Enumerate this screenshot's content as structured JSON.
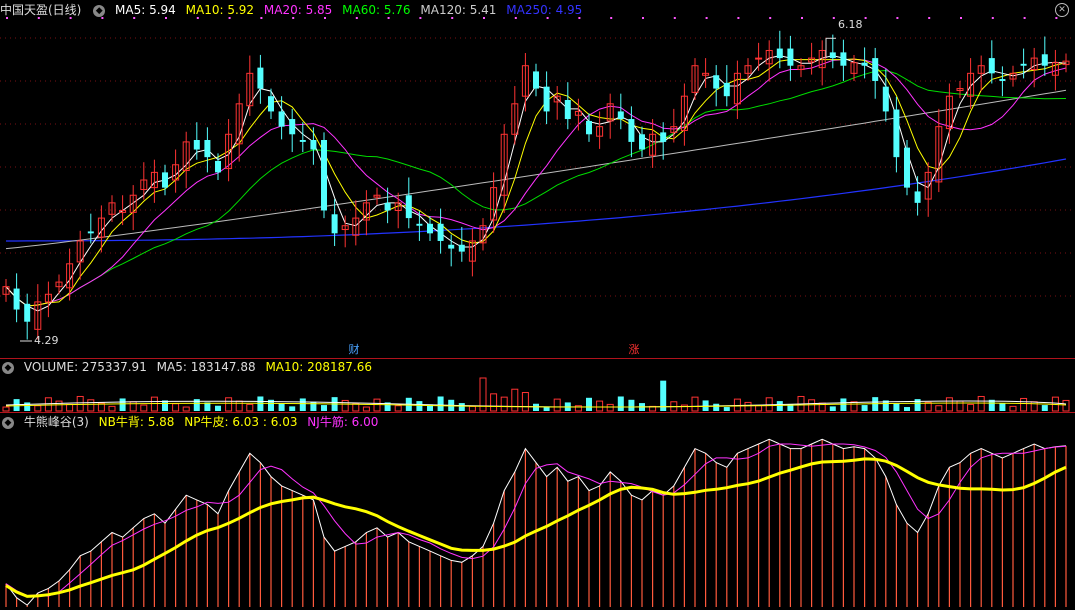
{
  "main": {
    "stock_title": "中国天盈(日线)",
    "ma": [
      {
        "label": "MA5: 5.94",
        "color": "#ffffff"
      },
      {
        "label": "MA10: 5.92",
        "color": "#ffff00"
      },
      {
        "label": "MA20: 5.85",
        "color": "#ff33ff"
      },
      {
        "label": "MA60: 5.76",
        "color": "#00ff00"
      },
      {
        "label": "MA120: 5.41",
        "color": "#cccccc"
      },
      {
        "label": "MA250: 4.95",
        "color": "#3333ff"
      }
    ],
    "high_label": "6.18",
    "low_label": "4.29",
    "event_badges": [
      {
        "text": "财",
        "color": "#4aa3ff"
      },
      {
        "text": "涨",
        "color": "#ff3333"
      }
    ],
    "close_icon": "close-icon"
  },
  "volume": {
    "label": "VOLUME: 275337.91",
    "ma5": "MA5: 183147.88",
    "ma10": "MA10: 208187.66",
    "colors": {
      "up": "#ff3333",
      "down": "#54ffff",
      "ma5": "#ffffff",
      "ma10": "#ffff00"
    }
  },
  "indicator": {
    "name": "牛熊峰谷(3)",
    "nb": "NB牛背: 5.88",
    "np": "NP牛皮: 6.03 : 6.03",
    "nj": "NJ牛筋: 6.00",
    "colors": {
      "nb": "#ffff00",
      "np": "#ffff00",
      "nj": "#ff33ff",
      "bars": "#ff5a3c",
      "white": "#ffffff",
      "yellow": "#ffff00",
      "magenta": "#ff33ff"
    }
  },
  "chart_data": {
    "type": "candlestick",
    "price_high": 6.18,
    "price_low": 4.29,
    "close_series": [
      4.55,
      4.4,
      4.32,
      4.45,
      4.5,
      4.58,
      4.7,
      4.85,
      4.9,
      5.0,
      5.1,
      5.05,
      5.15,
      5.25,
      5.3,
      5.2,
      5.35,
      5.5,
      5.45,
      5.4,
      5.3,
      5.55,
      5.75,
      5.95,
      5.85,
      5.7,
      5.6,
      5.55,
      5.5,
      5.45,
      5.05,
      4.9,
      4.95,
      5.0,
      5.1,
      5.15,
      5.05,
      5.1,
      5.0,
      4.95,
      4.9,
      4.85,
      4.8,
      4.78,
      4.85,
      4.95,
      5.2,
      5.55,
      5.75,
      6.0,
      5.85,
      5.7,
      5.8,
      5.65,
      5.7,
      5.55,
      5.6,
      5.75,
      5.65,
      5.5,
      5.45,
      5.55,
      5.5,
      5.6,
      5.8,
      6.0,
      5.95,
      5.85,
      5.8,
      5.95,
      6.0,
      6.05,
      6.1,
      6.05,
      6.0,
      6.0,
      6.05,
      6.1,
      6.05,
      6.0,
      6.02,
      6.0,
      5.9,
      5.7,
      5.4,
      5.2,
      5.1,
      5.3,
      5.6,
      5.8,
      5.85,
      5.95,
      6.0,
      5.95,
      5.9,
      5.95,
      6.0,
      6.05,
      6.0,
      6.02,
      6.03
    ]
  }
}
